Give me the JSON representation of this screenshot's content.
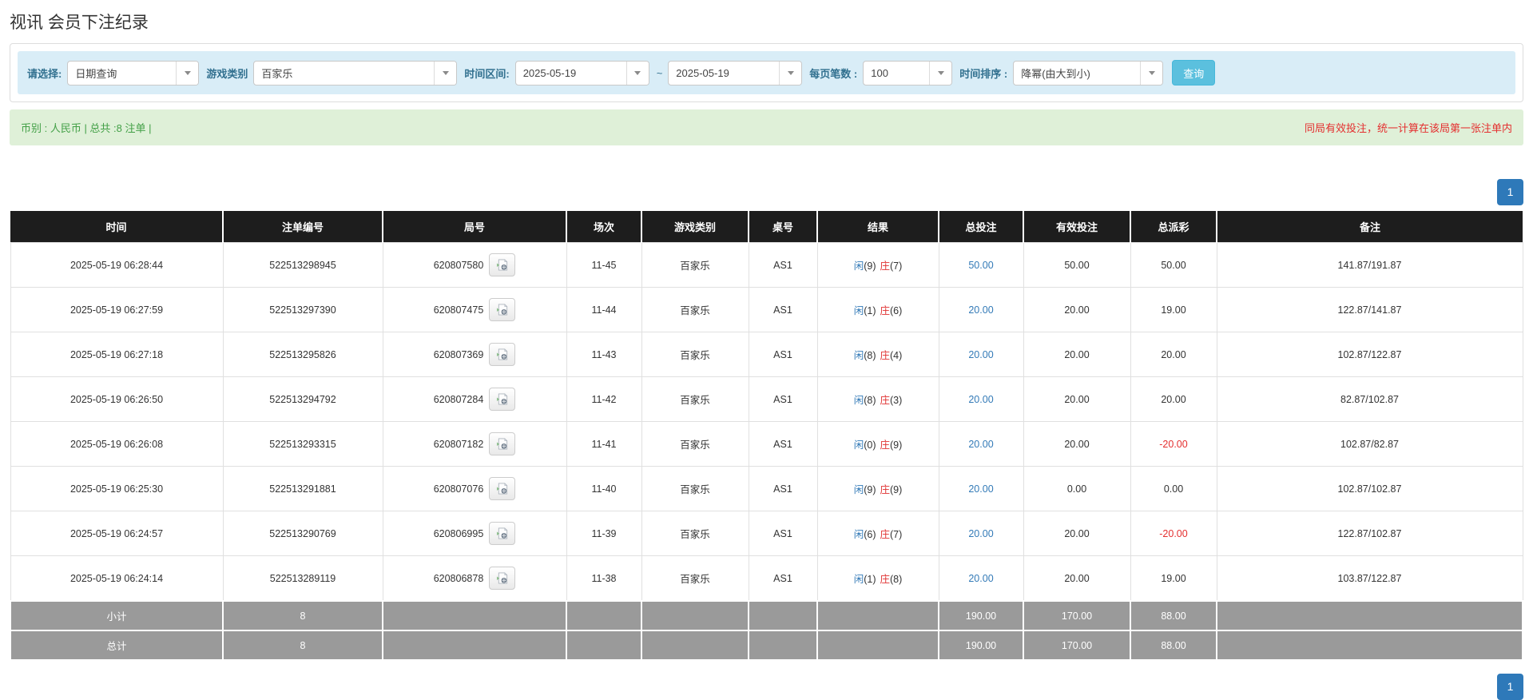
{
  "title": "视讯 会员下注纪录",
  "colors": {
    "filter_bar_bg": "#d9edf7",
    "filter_label": "#31708f",
    "search_button_bg": "#5bc0de",
    "summary_bg": "#dff0d8",
    "summary_green": "#43a047",
    "summary_red": "#e42f2f",
    "table_header_bg": "#1d1d1d",
    "link_blue": "#337ab7",
    "banker_red": "#e03131",
    "pagination_blue": "#2e79b9",
    "subtotal_gray": "#9a9a9a"
  },
  "filter_bar": {
    "fields": [
      {
        "name": "query-type",
        "label": "请选择:",
        "value": "日期查询"
      },
      {
        "name": "game-category",
        "label": "游戏类别",
        "value": "百家乐"
      },
      {
        "name": "date-from",
        "label": "时间区间:",
        "value": "2025-05-19"
      },
      {
        "name": "date-to",
        "label": "~",
        "value": "2025-05-19"
      },
      {
        "name": "page-size",
        "label": "每页笔数 :",
        "value": "100"
      },
      {
        "name": "time-sort",
        "label": "时间排序 :",
        "value": "降幂(由大到小)"
      }
    ],
    "search_button": "查询"
  },
  "summary_bar": {
    "left": "币别 : 人民币 | 总共 :8 注单 |",
    "right": "同局有效投注，统一计算在该局第一张注单内"
  },
  "pagination": {
    "page": "1"
  },
  "table": {
    "headers": [
      "时间",
      "注单编号",
      "局号",
      "场次",
      "游戏类别",
      "桌号",
      "结果",
      "总投注",
      "有效投注",
      "总派彩",
      "备注"
    ],
    "rows": [
      {
        "time": "2025-05-19 06:28:44",
        "bet_id": "522513298945",
        "round_id": "620807580",
        "session": "11-45",
        "game": "百家乐",
        "table_no": "AS1",
        "player_label": "闲",
        "player_score": "(9)",
        "banker_label": "庄",
        "banker_score": "(7)",
        "total_bet": "50.00",
        "valid_bet": "50.00",
        "payout": "50.00",
        "remark": "141.87/191.87"
      },
      {
        "time": "2025-05-19 06:27:59",
        "bet_id": "522513297390",
        "round_id": "620807475",
        "session": "11-44",
        "game": "百家乐",
        "table_no": "AS1",
        "player_label": "闲",
        "player_score": "(1)",
        "banker_label": "庄",
        "banker_score": "(6)",
        "total_bet": "20.00",
        "valid_bet": "20.00",
        "payout": "19.00",
        "remark": "122.87/141.87"
      },
      {
        "time": "2025-05-19 06:27:18",
        "bet_id": "522513295826",
        "round_id": "620807369",
        "session": "11-43",
        "game": "百家乐",
        "table_no": "AS1",
        "player_label": "闲",
        "player_score": "(8)",
        "banker_label": "庄",
        "banker_score": "(4)",
        "total_bet": "20.00",
        "valid_bet": "20.00",
        "payout": "20.00",
        "remark": "102.87/122.87"
      },
      {
        "time": "2025-05-19 06:26:50",
        "bet_id": "522513294792",
        "round_id": "620807284",
        "session": "11-42",
        "game": "百家乐",
        "table_no": "AS1",
        "player_label": "闲",
        "player_score": "(8)",
        "banker_label": "庄",
        "banker_score": "(3)",
        "total_bet": "20.00",
        "valid_bet": "20.00",
        "payout": "20.00",
        "remark": "82.87/102.87"
      },
      {
        "time": "2025-05-19 06:26:08",
        "bet_id": "522513293315",
        "round_id": "620807182",
        "session": "11-41",
        "game": "百家乐",
        "table_no": "AS1",
        "player_label": "闲",
        "player_score": "(0)",
        "banker_label": "庄",
        "banker_score": "(9)",
        "total_bet": "20.00",
        "valid_bet": "20.00",
        "payout": "-20.00",
        "remark": "102.87/82.87"
      },
      {
        "time": "2025-05-19 06:25:30",
        "bet_id": "522513291881",
        "round_id": "620807076",
        "session": "11-40",
        "game": "百家乐",
        "table_no": "AS1",
        "player_label": "闲",
        "player_score": "(9)",
        "banker_label": "庄",
        "banker_score": "(9)",
        "total_bet": "20.00",
        "valid_bet": "0.00",
        "payout": "0.00",
        "remark": "102.87/102.87"
      },
      {
        "time": "2025-05-19 06:24:57",
        "bet_id": "522513290769",
        "round_id": "620806995",
        "session": "11-39",
        "game": "百家乐",
        "table_no": "AS1",
        "player_label": "闲",
        "player_score": "(6)",
        "banker_label": "庄",
        "banker_score": "(7)",
        "total_bet": "20.00",
        "valid_bet": "20.00",
        "payout": "-20.00",
        "remark": "122.87/102.87"
      },
      {
        "time": "2025-05-19 06:24:14",
        "bet_id": "522513289119",
        "round_id": "620806878",
        "session": "11-38",
        "game": "百家乐",
        "table_no": "AS1",
        "player_label": "闲",
        "player_score": "(1)",
        "banker_label": "庄",
        "banker_score": "(8)",
        "total_bet": "20.00",
        "valid_bet": "20.00",
        "payout": "19.00",
        "remark": "103.87/122.87"
      }
    ],
    "subtotal": {
      "label": "小计",
      "count": "8",
      "total_bet": "190.00",
      "valid_bet": "170.00",
      "payout": "88.00"
    },
    "total": {
      "label": "总计",
      "count": "8",
      "total_bet": "190.00",
      "valid_bet": "170.00",
      "payout": "88.00"
    }
  }
}
